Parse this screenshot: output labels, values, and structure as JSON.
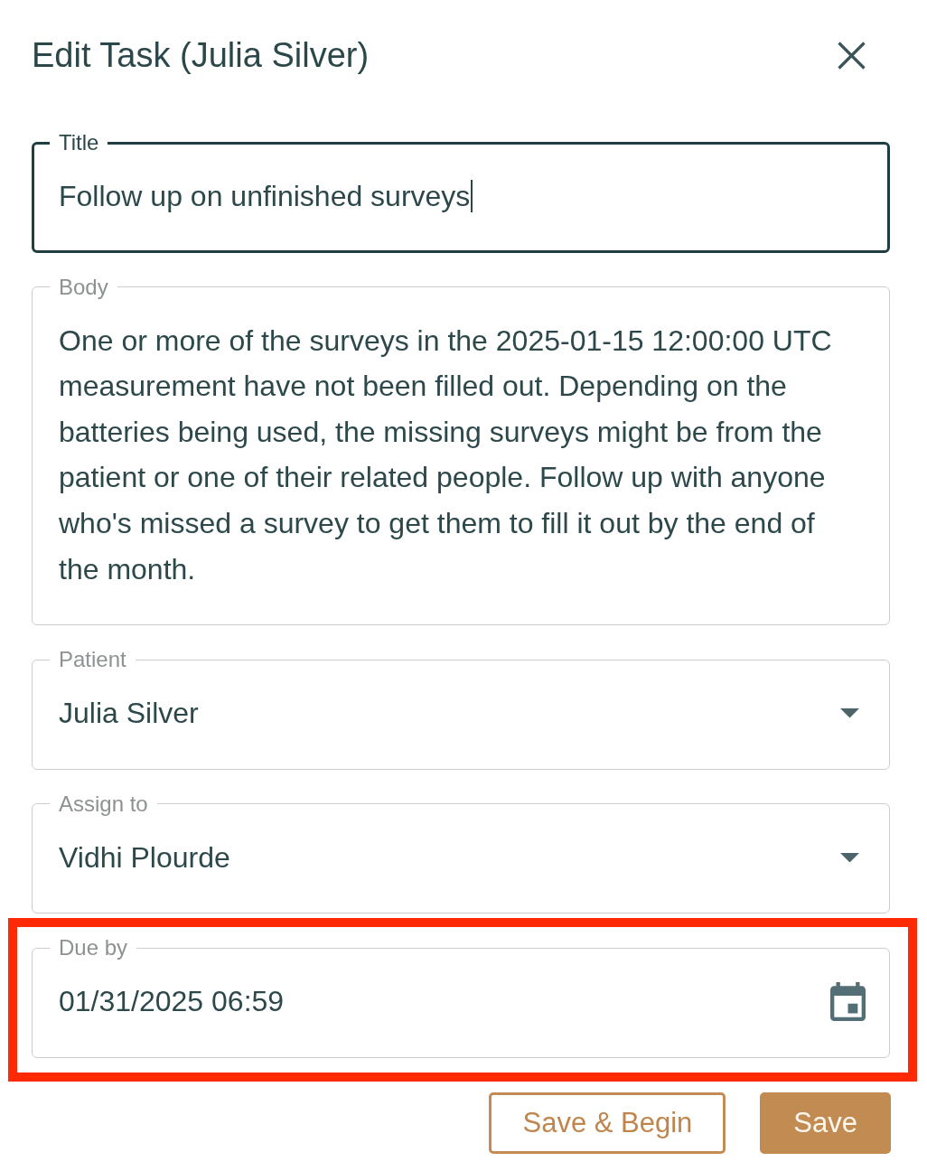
{
  "dialog": {
    "title": "Edit Task (Julia Silver)"
  },
  "fields": [
    {
      "kind": "text",
      "label": "Title",
      "value": "Follow up on unfinished surveys",
      "focused": true,
      "highlighted": false
    },
    {
      "kind": "multiline",
      "label": "Body",
      "value": "One or more of the surveys in the 2025-01-15 12:00:00 UTC measurement have not been filled out. Depending on the batteries being used, the missing surveys might be from the patient or one of their related people. Follow up with anyone who's missed a survey to get them to fill it out by the end of the month.",
      "focused": false,
      "highlighted": false
    },
    {
      "kind": "select",
      "label": "Patient",
      "value": "Julia Silver",
      "focused": false,
      "highlighted": false
    },
    {
      "kind": "select",
      "label": "Assign to",
      "value": "Vidhi Plourde",
      "focused": false,
      "highlighted": false
    },
    {
      "kind": "datetime",
      "label": "Due by",
      "value": "01/31/2025 06:59",
      "focused": false,
      "highlighted": true
    }
  ],
  "actions": [
    {
      "kind": "outlined",
      "label": "Save & Begin"
    },
    {
      "kind": "filled",
      "label": "Save"
    }
  ]
}
